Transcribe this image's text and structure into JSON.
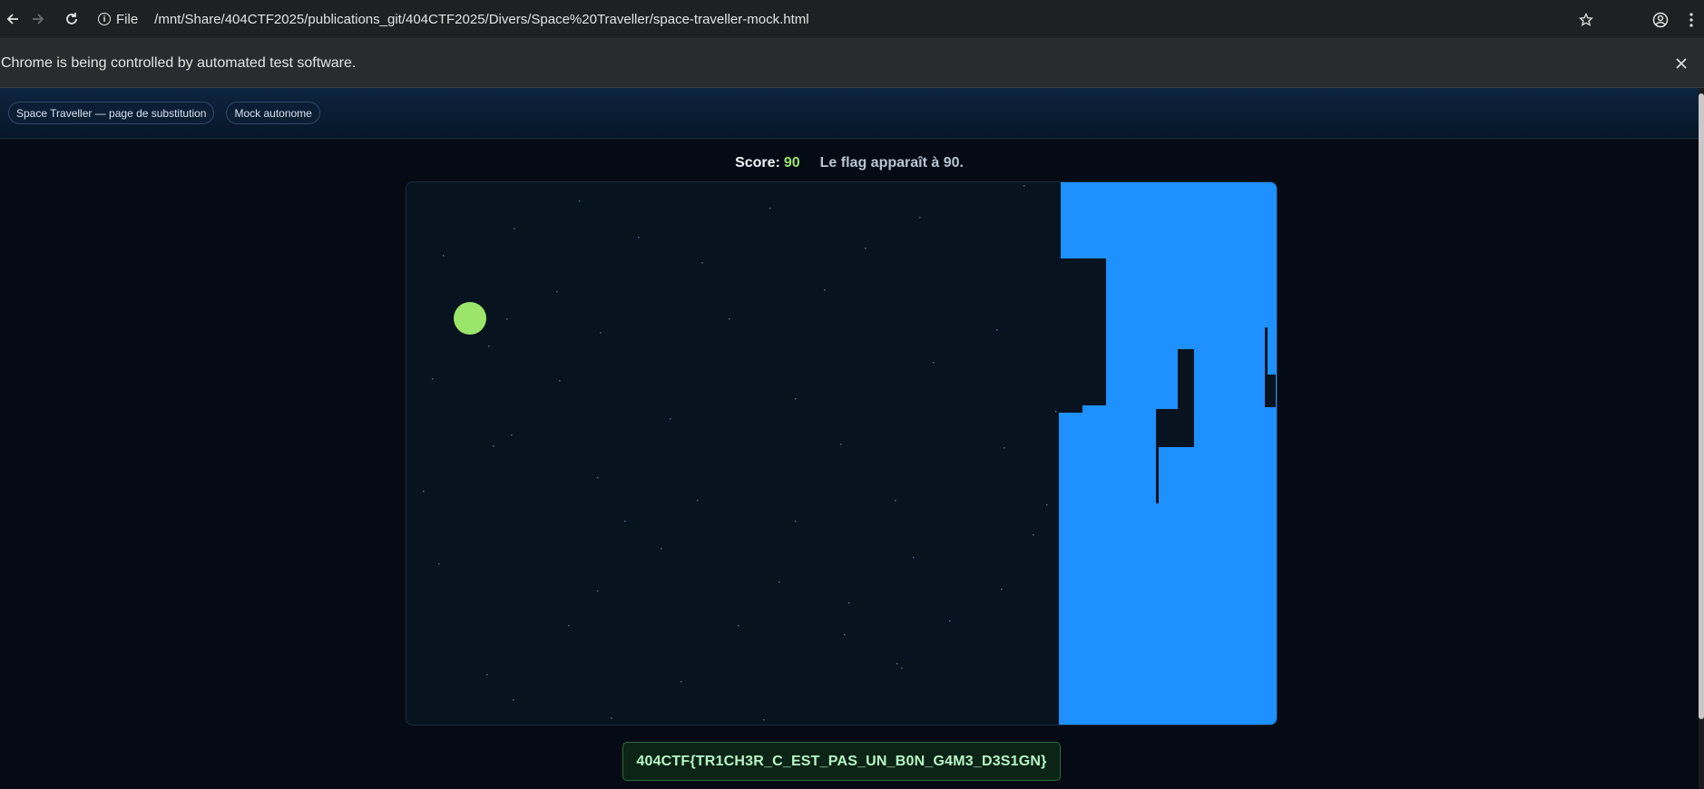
{
  "browser": {
    "site_info_label": "File",
    "url": "/mnt/Share/404CTF2025/publications_git/404CTF2025/Divers/Space%20Traveller/space-traveller-mock.html",
    "infobar_text": "Chrome is being controlled by automated test software."
  },
  "header": {
    "pills": [
      "Space Traveller — page de substitution",
      "Mock autonome"
    ]
  },
  "score": {
    "label": "Score:",
    "value": "90",
    "hint": "Le flag apparaît à 90."
  },
  "flag": "404CTF{TR1CH3R_C_EST_PAS_UN_B0N_G4M3_D3S1GN}",
  "colors": {
    "player": "#9be56a",
    "wall": "#1e90ff",
    "space": "#081320",
    "star": "#4a6a8a"
  }
}
